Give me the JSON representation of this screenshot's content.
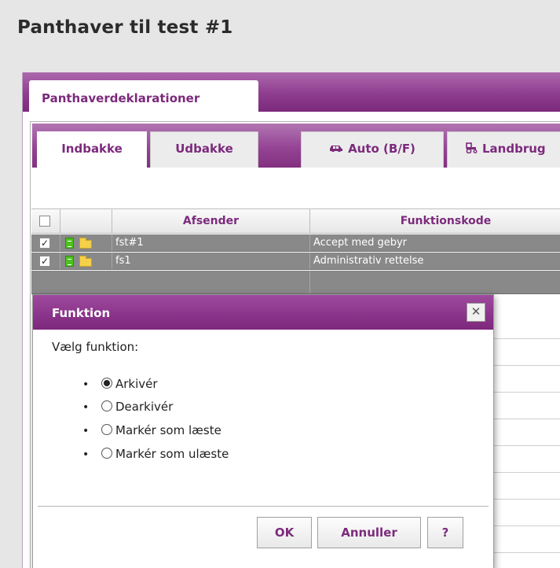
{
  "page": {
    "title": "Panthaver til test #1"
  },
  "outer_tabs": [
    {
      "label": "Panthaverdeklarationer"
    }
  ],
  "inner_tabs": [
    {
      "label": "Indbakke"
    },
    {
      "label": "Udbakke"
    },
    {
      "label": "Auto (B/F)",
      "icon": "car-icon"
    },
    {
      "label": "Landbrug",
      "icon": "tractor-icon"
    }
  ],
  "grid": {
    "columns": [
      "Afsender",
      "Funktionskode"
    ],
    "rows": [
      {
        "selected": true,
        "sender": "fst#1",
        "function_code": "Accept med gebyr"
      },
      {
        "selected": true,
        "sender": "fs1",
        "function_code": "Administrativ rettelse"
      }
    ]
  },
  "dialog": {
    "title": "Funktion",
    "close_symbol": "✕",
    "prompt": "Vælg funktion:",
    "options": [
      {
        "label": "Arkivér",
        "checked": true
      },
      {
        "label": "Dearkivér",
        "checked": false
      },
      {
        "label": "Markér som læste",
        "checked": false
      },
      {
        "label": "Markér som ulæste",
        "checked": false
      }
    ],
    "buttons": {
      "ok": "OK",
      "cancel": "Annuller",
      "help": "?"
    }
  },
  "colors": {
    "accent": "#8a338a",
    "row_selected": "#898989",
    "doc_icon": "#4cc21d",
    "folder_icon": "#f5d04a"
  }
}
